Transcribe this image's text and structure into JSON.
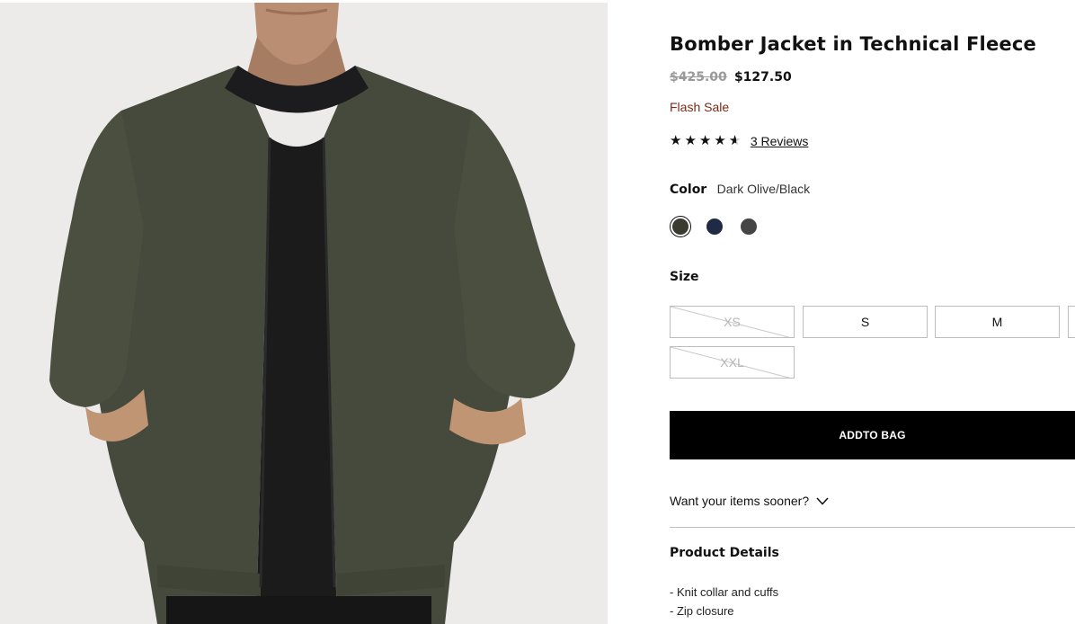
{
  "product": {
    "title": "Bomber Jacket in Technical Fleece",
    "price_original": "$425.00",
    "price_sale": "$127.50",
    "sale_label": "Flash Sale",
    "rating": 4.5,
    "rating_max": 5,
    "reviews_link": "3 Reviews"
  },
  "color": {
    "label": "Color",
    "selected": "Dark Olive/Black",
    "swatches": [
      {
        "name": "Dark Olive/Black",
        "hex": "#3c3b30",
        "selected": true
      },
      {
        "name": "Navy",
        "hex": "#1f2a44",
        "selected": false
      },
      {
        "name": "Charcoal",
        "hex": "#454545",
        "selected": false
      }
    ]
  },
  "size": {
    "label": "Size",
    "options": [
      {
        "label": "XS",
        "available": false
      },
      {
        "label": "S",
        "available": true
      },
      {
        "label": "M",
        "available": true
      },
      {
        "label": "XXL",
        "available": false
      }
    ]
  },
  "actions": {
    "add_to_bag": "ADDTO BAG",
    "sooner": "Want your items sooner?"
  },
  "details": {
    "heading": "Product Details",
    "items": [
      "- Knit collar and cuffs",
      "- Zip closure"
    ]
  },
  "icons": {
    "star": "star-icon",
    "chevron": "chevron-down-icon"
  }
}
